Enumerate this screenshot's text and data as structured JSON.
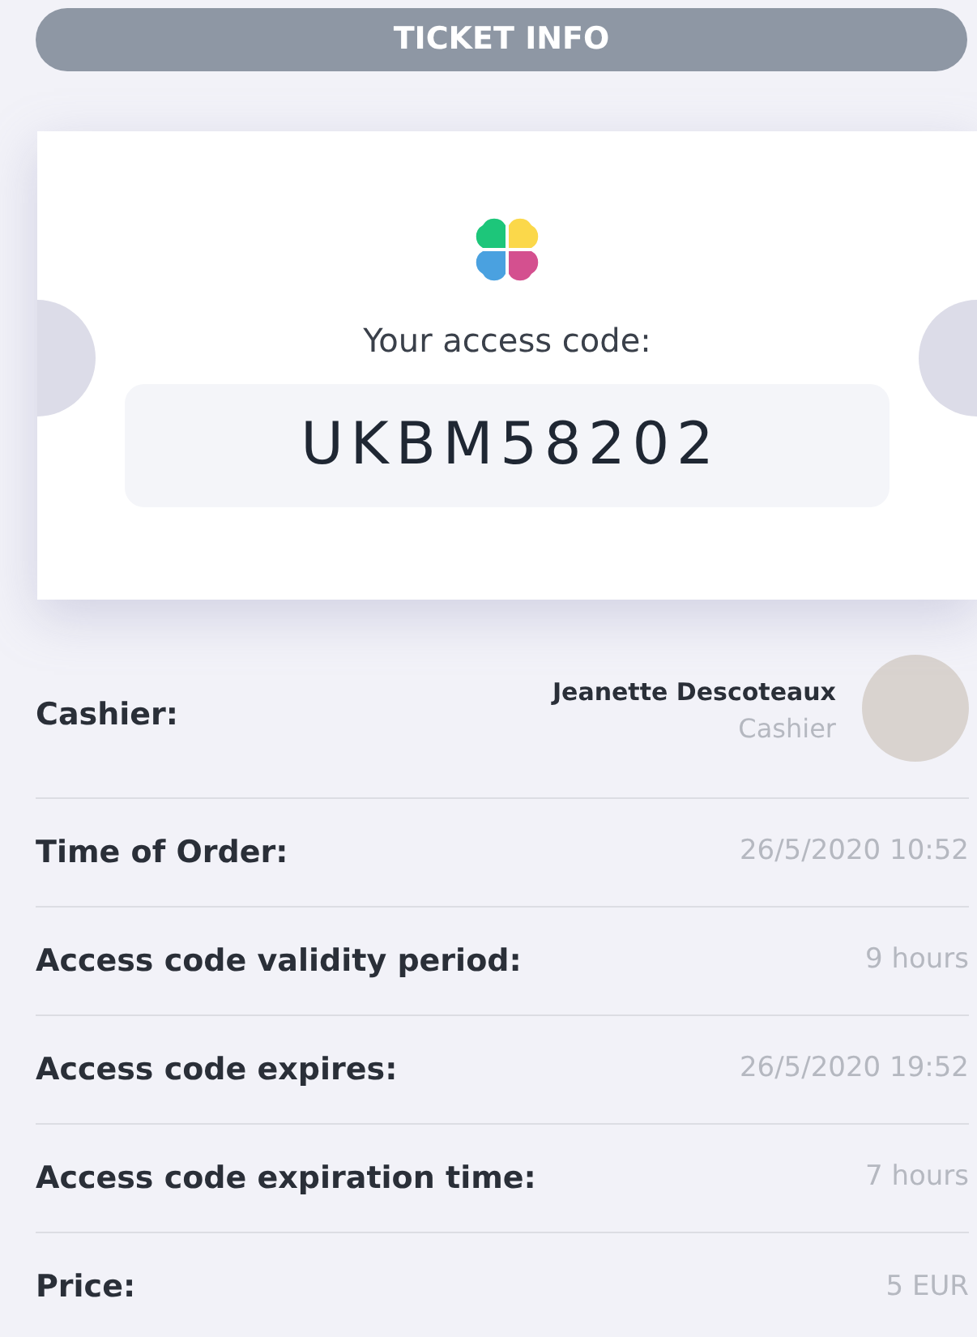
{
  "header": {
    "title": "TICKET INFO"
  },
  "ticket": {
    "prompt": "Your access code:",
    "code": "UKBM58202"
  },
  "cashier": {
    "label": "Cashier:",
    "name": "Jeanette Descoteaux",
    "role": "Cashier"
  },
  "details": [
    {
      "label": "Time of Order:",
      "value": "26/5/2020 10:52"
    },
    {
      "label": "Access code validity period:",
      "value": "9 hours"
    },
    {
      "label": "Access code expires:",
      "value": "26/5/2020 19:52"
    },
    {
      "label": "Access code expiration time:",
      "value": "7 hours"
    },
    {
      "label": "Price:",
      "value": "5 EUR"
    }
  ]
}
